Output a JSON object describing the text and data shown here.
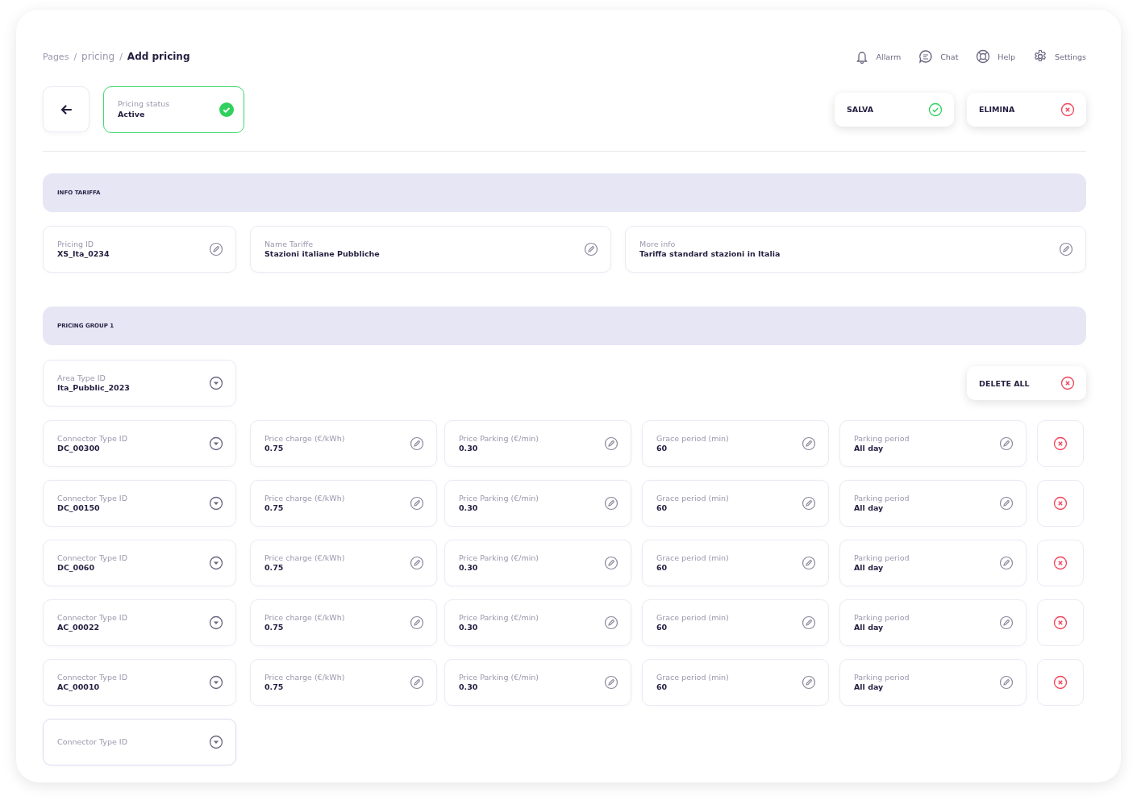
{
  "breadcrumb": [
    {
      "label": "Pages",
      "current": false
    },
    {
      "label": "pricing",
      "current": false,
      "separator": "/"
    },
    {
      "label": "Add pricing",
      "current": true,
      "separator": "/"
    }
  ],
  "top_actions": [
    {
      "kind": "bell",
      "label": "Allarm"
    },
    {
      "kind": "chat",
      "label": "Chat"
    },
    {
      "kind": "lifebuoy",
      "label": "Help"
    },
    {
      "kind": "gear",
      "label": "Settings"
    }
  ],
  "status_card": {
    "label": "Pricing status",
    "value": "Active",
    "active": true
  },
  "buttons": [
    {
      "label": "SALVA",
      "kind": "confirm"
    },
    {
      "label": "ELIMINA",
      "kind": "delete"
    }
  ],
  "info_section": {
    "title": "INFO TARIFFA",
    "fields": [
      {
        "label": "Pricing ID",
        "value": "XS_Ita_0234",
        "kind": "edit"
      },
      {
        "label": "Name Tariffe",
        "value": "Stazioni italiane Pubbliche",
        "kind": "edit"
      },
      {
        "label": "More info",
        "value": "Tariffa standard stazioni in Italia",
        "kind": "edit"
      }
    ]
  },
  "pricing_group": {
    "title": "PRICING GROUP 1",
    "area_field": {
      "label": "Area Type ID",
      "value": "Ita_Pubblic_2023",
      "kind": "select"
    },
    "delete_all": {
      "label": "DELETE ALL"
    },
    "rows": [
      {
        "fields": [
          {
            "label": "Connector Type ID",
            "value": "DC_00300",
            "kind": "select"
          },
          {
            "label": "Price charge (€/kWh)",
            "value": "0.75",
            "kind": "edit"
          },
          {
            "label": "Price Parking (€/min)",
            "value": "0.30",
            "kind": "edit"
          },
          {
            "label": "Grace period (min)",
            "value": "60",
            "kind": "edit"
          },
          {
            "label": "Parking period",
            "value": "All day",
            "kind": "edit"
          }
        ]
      },
      {
        "fields": [
          {
            "label": "Connector Type ID",
            "value": "DC_00150",
            "kind": "select"
          },
          {
            "label": "Price charge (€/kWh)",
            "value": "0.75",
            "kind": "edit"
          },
          {
            "label": "Price Parking (€/min)",
            "value": "0.30",
            "kind": "edit"
          },
          {
            "label": "Grace period (min)",
            "value": "60",
            "kind": "edit"
          },
          {
            "label": "Parking period",
            "value": "All day",
            "kind": "edit"
          }
        ]
      },
      {
        "fields": [
          {
            "label": "Connector Type ID",
            "value": "DC_0060",
            "kind": "select"
          },
          {
            "label": "Price charge (€/kWh)",
            "value": "0.75",
            "kind": "edit"
          },
          {
            "label": "Price Parking (€/min)",
            "value": "0.30",
            "kind": "edit"
          },
          {
            "label": "Grace period (min)",
            "value": "60",
            "kind": "edit"
          },
          {
            "label": "Parking period",
            "value": "All day",
            "kind": "edit"
          }
        ]
      },
      {
        "fields": [
          {
            "label": "Connector Type ID",
            "value": "AC_00022",
            "kind": "select"
          },
          {
            "label": "Price charge (€/kWh)",
            "value": "0.75",
            "kind": "edit"
          },
          {
            "label": "Price Parking (€/min)",
            "value": "0.30",
            "kind": "edit"
          },
          {
            "label": "Grace period (min)",
            "value": "60",
            "kind": "edit"
          },
          {
            "label": "Parking period",
            "value": "All day",
            "kind": "edit"
          }
        ]
      },
      {
        "fields": [
          {
            "label": "Connector Type ID",
            "value": "AC_00010",
            "kind": "select"
          },
          {
            "label": "Price charge (€/kWh)",
            "value": "0.75",
            "kind": "edit"
          },
          {
            "label": "Price Parking (€/min)",
            "value": "0.30",
            "kind": "edit"
          },
          {
            "label": "Grace period (min)",
            "value": "60",
            "kind": "edit"
          },
          {
            "label": "Parking period",
            "value": "All day",
            "kind": "edit"
          }
        ]
      }
    ],
    "new_field": {
      "placeholder": "Connector Type ID",
      "kind": "select"
    }
  }
}
